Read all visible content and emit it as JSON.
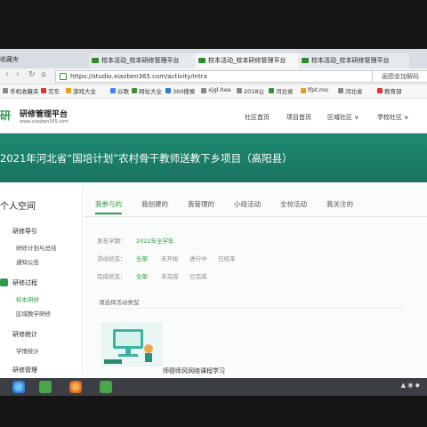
{
  "browser": {
    "left_label": "收藏夹",
    "tabs": [
      {
        "title": "校本活动_校本研修管理平台",
        "active": false
      },
      {
        "title": "校本活动_校本研修管理平台",
        "active": true
      },
      {
        "title": "校本活动_校本研修管理平台",
        "active": false
      }
    ],
    "url": "https://studio.xiaoben365.com/activity/intra",
    "search_placeholder": "画图金加解码",
    "bookmarks": [
      "手机收藏夹",
      "京东",
      "游戏大全",
      "谷歌",
      "网址大全",
      "360搜索",
      "xjgl.hee",
      "2018公",
      "河北省",
      "lfpt.mo",
      "河北省",
      "教育部"
    ]
  },
  "site": {
    "logo_mark": "研",
    "logo_title": "研修管理平台",
    "logo_url": "www.xiaoben365.com",
    "nav": [
      "社区首页",
      "项目首页",
      "区域社区 ∨",
      "学校社区 ∨"
    ]
  },
  "banner": {
    "title": "2021年河北省“国培计划”农村骨干教师送教下乡项目（高阳县）"
  },
  "sidebar": {
    "title": "个人空间",
    "sections": [
      {
        "label": "研修导引",
        "items": [
          "研修计划与总结",
          "通知公告"
        ]
      },
      {
        "label": "研修过程",
        "items": [
          "校本研修",
          "区域教学研修"
        ]
      },
      {
        "label": "研修统计",
        "items": [
          "学情统计"
        ]
      },
      {
        "label": "研修管理",
        "items": []
      }
    ]
  },
  "main": {
    "tabs": [
      "我参与的",
      "我创建的",
      "我管理的",
      "小组活动",
      "全校活动",
      "我关注的"
    ],
    "filters": [
      {
        "label": "发布学期：",
        "options": [
          "2022年全学年"
        ]
      },
      {
        "label": "活动状态：",
        "options": [
          "全部",
          "未开始",
          "进行中",
          "已结束"
        ]
      },
      {
        "label": "完成状态：",
        "options": [
          "全部",
          "未完成",
          "已完成"
        ]
      }
    ],
    "type_select": "请选择活动类型",
    "card": {
      "title": "师德师风网络课程学习"
    }
  },
  "colors": {
    "accent": "#2e9a49",
    "banner": "#1f8a72"
  }
}
